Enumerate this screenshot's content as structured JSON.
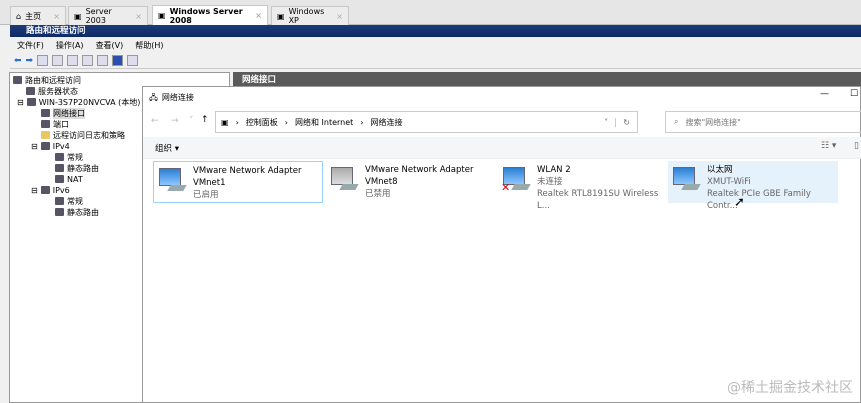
{
  "tabs": [
    {
      "label": "主页"
    },
    {
      "label": "Server 2003"
    },
    {
      "label": "Windows Server 2008"
    },
    {
      "label": "Windows XP"
    }
  ],
  "app_title": "路由和远程访问",
  "menu": [
    "文件(F)",
    "操作(A)",
    "查看(V)",
    "帮助(H)"
  ],
  "tree": [
    "路由和远程访问",
    "服务器状态",
    "WIN-3S7P20NVCVA (本地)",
    "网络接口",
    "端口",
    "远程访问日志和策略",
    "IPv4",
    "常规",
    "静态路由",
    "NAT",
    "IPv6",
    "常规",
    "静态路由"
  ],
  "right_header": "网络接口",
  "net": {
    "title": "网络连接",
    "breadcrumb": [
      "控制面板",
      "网络和 Internet",
      "网络连接"
    ],
    "search_placeholder": "搜索\"网络连接\"",
    "organize": "组织 ▾",
    "items": [
      {
        "name": "VMware Network Adapter",
        "line2": "VMnet1",
        "line3": "已启用"
      },
      {
        "name": "VMware Network Adapter",
        "line2": "VMnet8",
        "line3": "已禁用"
      },
      {
        "name": "WLAN 2",
        "line2": "未连接",
        "line3": "Realtek RTL8191SU Wireless L..."
      },
      {
        "name": "以太网",
        "line2": "XMUT-WiFi",
        "line3": "Realtek PCIe GBE Family Contr..."
      }
    ]
  },
  "watermark": "@稀土掘金技术社区"
}
